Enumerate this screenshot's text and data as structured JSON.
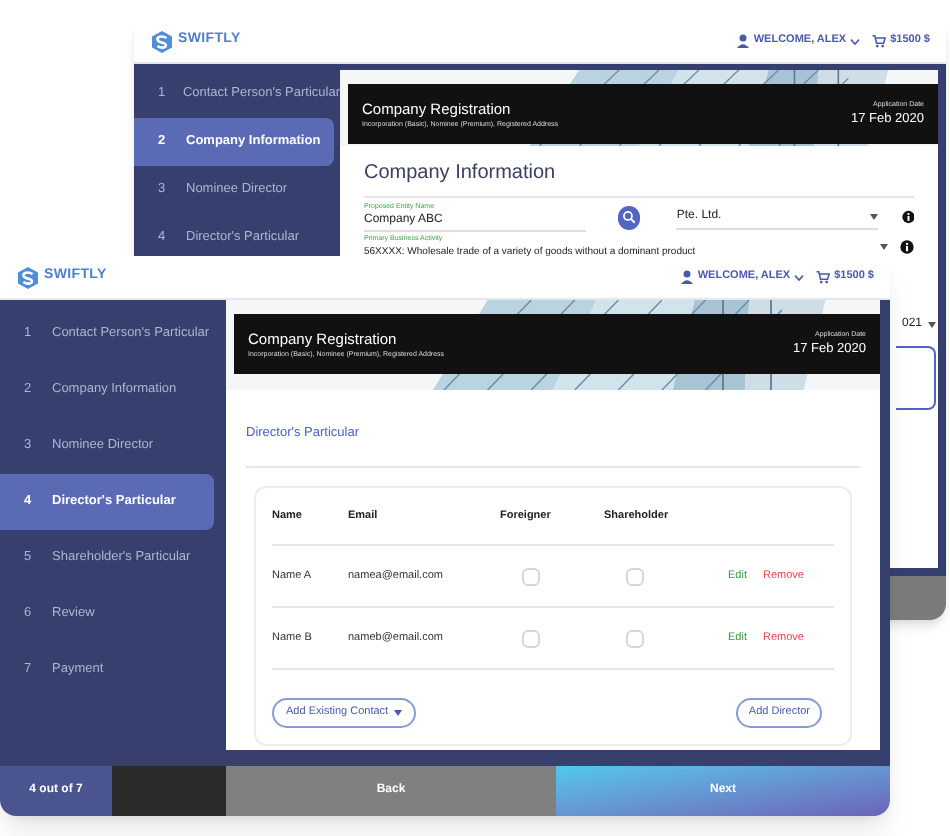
{
  "back_window": {
    "brand": "SWIFTLY",
    "user_menu": "WELCOME, ALEX",
    "cart": "$1500 $",
    "steps": [
      {
        "number": "1",
        "label": "Contact Person's Particular",
        "selected": false
      },
      {
        "number": "2",
        "label": "Company Information",
        "selected": true
      },
      {
        "number": "3",
        "label": "Nominee Director",
        "selected": false
      },
      {
        "number": "4",
        "label": "Director's Particular",
        "selected": false
      }
    ],
    "banner": {
      "title": "Company Registration",
      "subtitle": "Incorporation (Basic), Nominee (Premium), Registered Address",
      "date_label": "Application Date",
      "date": "17 Feb 2020"
    },
    "section_title": "Company Information",
    "fields": [
      {
        "label": "Proposed Entity Name",
        "value": "Company ABC"
      },
      {
        "label": "Primary Business Activity",
        "value": "56XXXX: Wholesale trade of a variety of goods without a dominant product"
      }
    ],
    "entity_type": "Pte. Ltd.",
    "date_dropdown": "021"
  },
  "front_window": {
    "brand": "SWIFTLY",
    "user_menu": "WELCOME, ALEX",
    "cart": "$1500 $",
    "steps": [
      {
        "number": "1",
        "label": "Contact Person's Particular",
        "selected": false
      },
      {
        "number": "2",
        "label": "Company Information",
        "selected": false
      },
      {
        "number": "3",
        "label": "Nominee Director",
        "selected": false
      },
      {
        "number": "4",
        "label": "Director's Particular",
        "selected": true
      },
      {
        "number": "5",
        "label": "Shareholder's Particular",
        "selected": false
      },
      {
        "number": "6",
        "label": "Review",
        "selected": false
      },
      {
        "number": "7",
        "label": "Payment",
        "selected": false
      }
    ],
    "banner": {
      "title": "Company Registration",
      "subtitle": "Incorporation (Basic), Nominee (Premium), Registered Address",
      "date_label": "Application Date",
      "date": "17 Feb 2020"
    },
    "section_link": "Director's Particular",
    "table": {
      "columns": [
        "Name",
        "Email",
        "Foreigner",
        "Shareholder"
      ],
      "rows": [
        {
          "name": "Name A",
          "email": "namea@email.com",
          "foreigner": false,
          "shareholder": false,
          "actions": [
            {
              "label": "Edit",
              "kind": "edit"
            },
            {
              "label": "Remove",
              "kind": "remove"
            }
          ]
        },
        {
          "name": "Name B",
          "email": "nameb@email.com",
          "foreigner": false,
          "shareholder": false,
          "actions": [
            {
              "label": "Edit",
              "kind": "edit"
            },
            {
              "label": "Remove",
              "kind": "remove"
            }
          ]
        }
      ]
    },
    "add_contact_button": "Add Existing Contact",
    "add_director_button": "Add Director",
    "progress": "4 out of 7",
    "back_button": "Back",
    "next_button": "Next"
  }
}
